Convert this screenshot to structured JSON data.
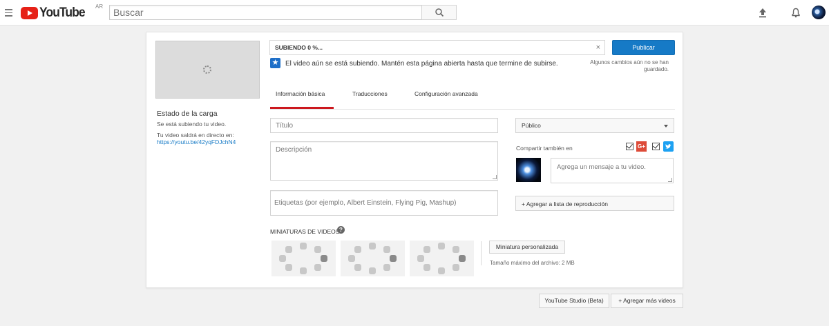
{
  "header": {
    "logo_text": "YouTube",
    "country_code": "AR",
    "search_placeholder": "Buscar"
  },
  "upload": {
    "status_title": "Estado de la carga",
    "status_text": "Se está subiendo tu video.",
    "live_text": "Tu video saldrá en directo en:",
    "video_link": "https://youtu.be/42yqFDJchN4",
    "progress_label": "SUBIENDO 0 %...",
    "progress_fraction": 0,
    "close_glyph": "×",
    "publish_label": "Publicar",
    "unsaved_note": "Algunos cambios aún no se han guardado.",
    "info_message": "El video aún se está subiendo. Mantén esta página abierta hasta que termine de subirse."
  },
  "tabs": [
    {
      "label": "Información básica",
      "active": true
    },
    {
      "label": "Traducciones",
      "active": false
    },
    {
      "label": "Configuración avanzada",
      "active": false
    }
  ],
  "form": {
    "title_placeholder": "Título",
    "description_placeholder": "Descripción",
    "tags_placeholder": "Etiquetas (por ejemplo, Albert Einstein, Flying Pig, Mashup)",
    "privacy_value": "Público",
    "share_label": "Compartir también en",
    "share_google_plus": {
      "checked": true,
      "glyph": "G+"
    },
    "share_twitter": {
      "checked": true
    },
    "share_message_placeholder": "Agrega un mensaje a tu video.",
    "playlist_button": "+ Agregar a lista de reproducción"
  },
  "thumbnails": {
    "title": "MINIATURAS DE VIDEOS",
    "help_glyph": "?",
    "custom_button": "Miniatura personalizada",
    "max_size_note": "Tamaño máximo del archivo: 2 MB"
  },
  "footer": {
    "studio_button": "YouTube Studio (Beta)",
    "add_more_button": "+ Agregar más videos"
  },
  "colors": {
    "brand_red": "#e62117",
    "publish_blue": "#167ac6",
    "active_tab_red": "#cc181e",
    "google_plus_red": "#dd4b39",
    "twitter_blue": "#1da1f2"
  }
}
